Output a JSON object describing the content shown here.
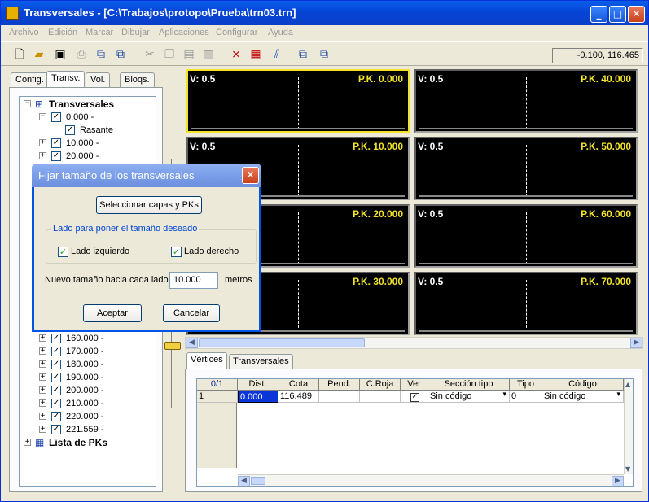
{
  "window": {
    "title": "Transversales - [C:\\Trabajos\\protopo\\Prueba\\trn03.trn]"
  },
  "menu": [
    "Archivo",
    "Edición",
    "Marcar",
    "Dibujar",
    "Aplicaciones",
    "Configurar",
    "Ayuda"
  ],
  "coords": "-0.100, 116.465",
  "left_tabs": [
    "Config.",
    "Transv.",
    "Vol.",
    "Bloqs."
  ],
  "tree": {
    "root": "Transversales",
    "first": "0.000 -",
    "rasante": "Rasante",
    "items_top": [
      "10.000 -",
      "20.000 -"
    ],
    "items_bottom": [
      "160.000 -",
      "170.000 -",
      "180.000 -",
      "190.000 -",
      "200.000 -",
      "210.000 -",
      "220.000 -",
      "221.559 -"
    ],
    "pk_list": "Lista de PKs"
  },
  "sections": [
    {
      "v": "V: 0.5",
      "pk": "P.K. 0.000"
    },
    {
      "v": "V: 0.5",
      "pk": "P.K. 40.000"
    },
    {
      "v": "V: 0.5",
      "pk": "P.K. 10.000"
    },
    {
      "v": "V: 0.5",
      "pk": "P.K. 50.000"
    },
    {
      "v": "",
      "pk": "P.K. 20.000"
    },
    {
      "v": "V: 0.5",
      "pk": "P.K. 60.000"
    },
    {
      "v": "",
      "pk": "P.K. 30.000"
    },
    {
      "v": "V: 0.5",
      "pk": "P.K. 70.000"
    }
  ],
  "bottom_tabs": [
    "Vértices",
    "Transversales"
  ],
  "table": {
    "headers": [
      "0/1",
      "Dist.",
      "Cota",
      "Pend.",
      "C.Roja",
      "Ver",
      "Sección tipo",
      "Tipo",
      "Código"
    ],
    "row": {
      "index": "1",
      "dist": "0.000",
      "cota": "116.489",
      "pend": "",
      "croja": "",
      "ver": "✓",
      "seccion": "Sin código",
      "tipo": "0",
      "codigo": "Sin código"
    }
  },
  "dialog": {
    "title": "Fijar tamaño de los transversales",
    "select_button": "Seleccionar capas y PKs",
    "group_label": "Lado para poner el tamaño deseado",
    "left_label": "Lado izquierdo",
    "right_label": "Lado derecho",
    "size_label": "Nuevo tamaño hacia cada lado",
    "size_value": "10.000",
    "unit": "metros",
    "accept": "Aceptar",
    "cancel": "Cancelar"
  },
  "colors": {
    "accent": "#0054e3",
    "pk_text": "#f2e32a",
    "selected_border": "#f2e32a"
  }
}
